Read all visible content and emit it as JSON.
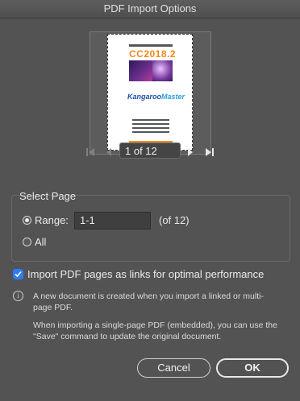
{
  "window": {
    "title": "PDF Import Options"
  },
  "preview": {
    "headline": "CC2018.2",
    "logo_main": "Kangaroo",
    "logo_accent": "Master"
  },
  "navigation": {
    "current_page_display": "1 of 12",
    "icons": [
      "first-page-icon",
      "previous-page-icon",
      "next-page-icon",
      "last-page-icon"
    ]
  },
  "select_page": {
    "group_label": "Select Page",
    "range_label": "Range:",
    "range_value": "1-1",
    "range_suffix": "(of 12)",
    "all_label": "All",
    "selected": "range"
  },
  "import_links": {
    "label": "Import PDF pages as links for optimal performance",
    "checked": true
  },
  "info": {
    "line1": "A new document is created when you import a linked or multi-",
    "line2": "page PDF.",
    "line3": "When importing a single-page PDF (embedded), you can use the",
    "line4": "\"Save\" command to update the original document."
  },
  "buttons": {
    "cancel": "Cancel",
    "ok": "OK"
  },
  "colors": {
    "background": "#535353",
    "accent": "#2e7cf6"
  }
}
